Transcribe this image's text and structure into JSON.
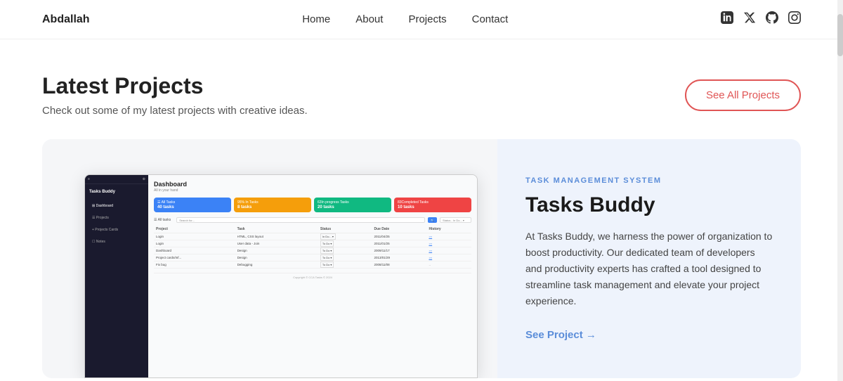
{
  "brand": "Abdallah",
  "nav": {
    "links": [
      {
        "label": "Home",
        "href": "#"
      },
      {
        "label": "About",
        "href": "#"
      },
      {
        "label": "Projects",
        "href": "#"
      },
      {
        "label": "Contact",
        "href": "#"
      }
    ],
    "icons": [
      {
        "name": "linkedin-icon",
        "symbol": "in"
      },
      {
        "name": "twitter-icon",
        "symbol": "𝕏"
      },
      {
        "name": "github-icon",
        "symbol": "⌥"
      },
      {
        "name": "instagram-icon",
        "symbol": "◻"
      }
    ]
  },
  "section": {
    "title": "Latest Projects",
    "subtitle": "Check out some of my latest projects with creative ideas.",
    "see_all_label": "See All Projects"
  },
  "project": {
    "category": "TASK MANAGEMENT SYSTEM",
    "title": "Tasks Buddy",
    "description": "At Tasks Buddy, we harness the power of organization to boost productivity. Our dedicated team of developers and productivity experts has crafted a tool designed to streamline task management and elevate your project experience.",
    "see_project_label": "See Project →",
    "mockup": {
      "brand": "Tasks Buddy",
      "topbar_icon1": "≡",
      "topbar_icon2": "⊕",
      "sidebar_items": [
        {
          "label": "Dashboard",
          "active": true
        },
        {
          "label": "Projects",
          "active": false
        },
        {
          "label": "Projects Cards",
          "active": false
        },
        {
          "label": "Notes",
          "active": false
        }
      ],
      "dashboard_title": "Dashboard",
      "dashboard_subtitle": "All in your hand",
      "cards": [
        {
          "label": "All Tasks",
          "count": "40 tasks",
          "color": "blue"
        },
        {
          "label": "95% In Tasks",
          "count": "8 tasks",
          "color": "yellow"
        },
        {
          "label": "63In progress Tasks",
          "count": "20 tasks",
          "color": "green"
        },
        {
          "label": "83Completed Tasks",
          "count": "10 tasks",
          "color": "red"
        }
      ],
      "table": {
        "filter_label": "All tasks",
        "search_placeholder": "Search for...",
        "search_btn": "🔍",
        "status_filter": "Status - In Do...",
        "columns": [
          "Project",
          "Task",
          "Status",
          "Due Date",
          "History"
        ],
        "rows": [
          {
            "project": "Login",
            "task": "HTML, CSS layout",
            "status": "In Do...",
            "due": "2011/04/25",
            "history": ">>"
          },
          {
            "project": "Login",
            "task": "User data - Join",
            "status": "To Do",
            "due": "2011/01/25",
            "history": ">>"
          },
          {
            "project": "Dashboard",
            "task": "Design",
            "status": "To Do",
            "due": "2009/11/17",
            "history": ">>"
          },
          {
            "project": "Project cards/Inf...",
            "task": "Design",
            "status": "To Do",
            "due": "2013/01/29",
            "history": ">>"
          },
          {
            "project": "Fix bug",
            "task": "Debugging",
            "status": "To Do",
            "due": "2008/11/08",
            "history": "--"
          }
        ]
      },
      "footer": "Copyright © CCA Tasks © 2024"
    }
  }
}
